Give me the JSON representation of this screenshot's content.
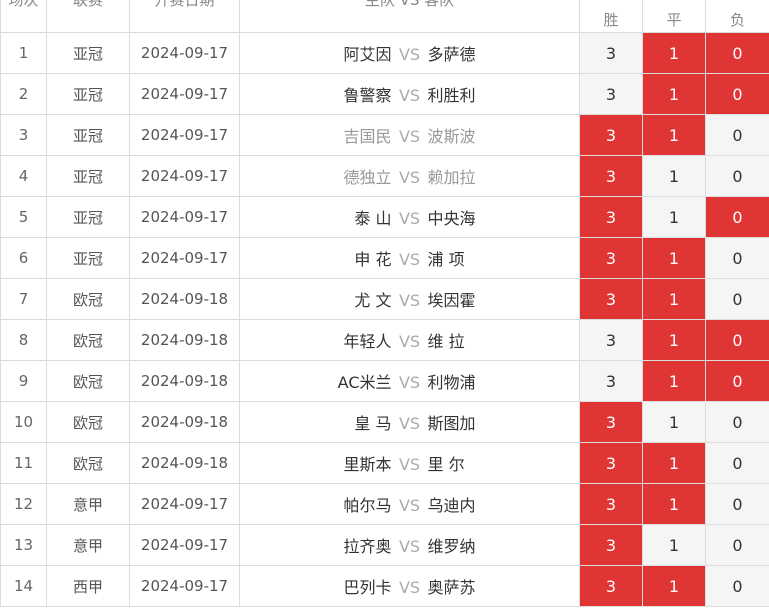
{
  "header": {
    "round": "场次",
    "league": "联赛",
    "date": "开赛日期",
    "teams": "主队 VS 客队",
    "win": "胜",
    "draw": "平",
    "lose": "负"
  },
  "vs_label": "VS",
  "colors": {
    "selected": "#e03535",
    "unselected": "#f5f5f5"
  },
  "matches": [
    {
      "no": "1",
      "league": "亚冠",
      "date": "2024-09-17",
      "home": "阿艾因",
      "away": "多萨德",
      "win": "3",
      "draw": "1",
      "lose": "0",
      "selected": [
        "draw",
        "lose"
      ],
      "dim": false
    },
    {
      "no": "2",
      "league": "亚冠",
      "date": "2024-09-17",
      "home": "鲁警察",
      "away": "利胜利",
      "win": "3",
      "draw": "1",
      "lose": "0",
      "selected": [
        "draw",
        "lose"
      ],
      "dim": false
    },
    {
      "no": "3",
      "league": "亚冠",
      "date": "2024-09-17",
      "home": "吉国民",
      "away": "波斯波",
      "win": "3",
      "draw": "1",
      "lose": "0",
      "selected": [
        "win",
        "draw"
      ],
      "dim": true
    },
    {
      "no": "4",
      "league": "亚冠",
      "date": "2024-09-17",
      "home": "德独立",
      "away": "赖加拉",
      "win": "3",
      "draw": "1",
      "lose": "0",
      "selected": [
        "win"
      ],
      "dim": true
    },
    {
      "no": "5",
      "league": "亚冠",
      "date": "2024-09-17",
      "home": "泰 山",
      "away": "中央海",
      "win": "3",
      "draw": "1",
      "lose": "0",
      "selected": [
        "win",
        "lose"
      ],
      "dim": false
    },
    {
      "no": "6",
      "league": "亚冠",
      "date": "2024-09-17",
      "home": "申 花",
      "away": "浦 项",
      "win": "3",
      "draw": "1",
      "lose": "0",
      "selected": [
        "win",
        "draw"
      ],
      "dim": false
    },
    {
      "no": "7",
      "league": "欧冠",
      "date": "2024-09-18",
      "home": "尤 文",
      "away": "埃因霍",
      "win": "3",
      "draw": "1",
      "lose": "0",
      "selected": [
        "win",
        "draw"
      ],
      "dim": false
    },
    {
      "no": "8",
      "league": "欧冠",
      "date": "2024-09-18",
      "home": "年轻人",
      "away": "维 拉",
      "win": "3",
      "draw": "1",
      "lose": "0",
      "selected": [
        "draw",
        "lose"
      ],
      "dim": false
    },
    {
      "no": "9",
      "league": "欧冠",
      "date": "2024-09-18",
      "home": "AC米兰",
      "away": "利物浦",
      "win": "3",
      "draw": "1",
      "lose": "0",
      "selected": [
        "draw",
        "lose"
      ],
      "dim": false
    },
    {
      "no": "10",
      "league": "欧冠",
      "date": "2024-09-18",
      "home": "皇 马",
      "away": "斯图加",
      "win": "3",
      "draw": "1",
      "lose": "0",
      "selected": [
        "win"
      ],
      "dim": false
    },
    {
      "no": "11",
      "league": "欧冠",
      "date": "2024-09-18",
      "home": "里斯本",
      "away": "里 尔",
      "win": "3",
      "draw": "1",
      "lose": "0",
      "selected": [
        "win",
        "draw"
      ],
      "dim": false
    },
    {
      "no": "12",
      "league": "意甲",
      "date": "2024-09-17",
      "home": "帕尔马",
      "away": "乌迪内",
      "win": "3",
      "draw": "1",
      "lose": "0",
      "selected": [
        "win",
        "draw"
      ],
      "dim": false
    },
    {
      "no": "13",
      "league": "意甲",
      "date": "2024-09-17",
      "home": "拉齐奥",
      "away": "维罗纳",
      "win": "3",
      "draw": "1",
      "lose": "0",
      "selected": [
        "win"
      ],
      "dim": false
    },
    {
      "no": "14",
      "league": "西甲",
      "date": "2024-09-17",
      "home": "巴列卡",
      "away": "奥萨苏",
      "win": "3",
      "draw": "1",
      "lose": "0",
      "selected": [
        "win",
        "draw"
      ],
      "dim": false
    }
  ]
}
